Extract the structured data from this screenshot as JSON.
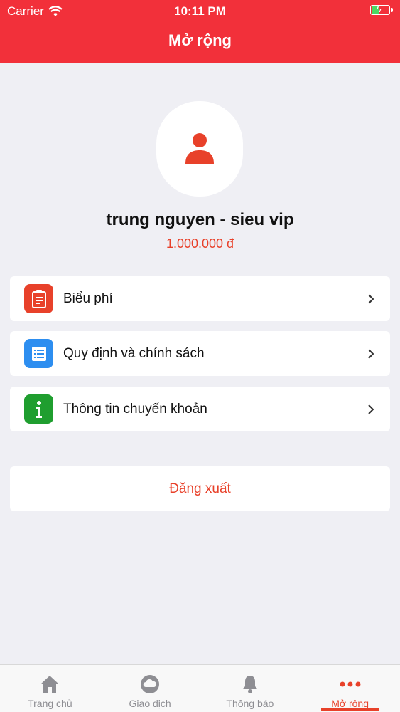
{
  "status_bar": {
    "carrier": "Carrier",
    "time": "10:11 PM"
  },
  "header": {
    "title": "Mở rộng"
  },
  "profile": {
    "name": "trung nguyen - sieu vip",
    "balance": "1.000.000 đ"
  },
  "menu": {
    "items": [
      {
        "label": "Biểu phí",
        "icon": "clipboard-icon",
        "color": "#e8412a"
      },
      {
        "label": "Quy định và chính sách",
        "icon": "list-document-icon",
        "color": "#2d8ef0"
      },
      {
        "label": "Thông tin chuyển khoản",
        "icon": "info-icon",
        "color": "#1f9e2f"
      }
    ]
  },
  "logout": {
    "label": "Đăng xuất"
  },
  "tabbar": {
    "tabs": [
      {
        "label": "Trang chủ",
        "icon": "home-icon"
      },
      {
        "label": "Giao dịch",
        "icon": "cloud-icon"
      },
      {
        "label": "Thông báo",
        "icon": "bell-icon"
      },
      {
        "label": "Mở rộng",
        "icon": "more-dots-icon",
        "active": true
      }
    ]
  },
  "colors": {
    "brand": "#f2303a",
    "accent": "#e8412a",
    "background": "#efeff4"
  }
}
